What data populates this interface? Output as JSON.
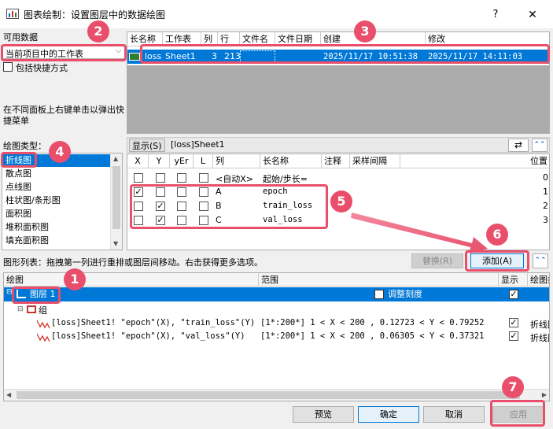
{
  "window": {
    "title": "图表绘制：设置图层中的数据绘图",
    "help_label": "?",
    "close_label": "✕"
  },
  "left": {
    "available_data_label": "可用数据",
    "source_selected": "当前项目中的工作表",
    "shortcut_label": "包括快捷方式",
    "hint": "在不同面板上右键单击以弹出快捷菜单",
    "plot_type_label": "绘图类型：",
    "plot_types": [
      "折线图",
      "散点图",
      "点线图",
      "柱状图/条形图",
      "面积图",
      "堆积面积图",
      "填充面积图"
    ]
  },
  "worksheets": {
    "columns": [
      "长名称",
      "工作表",
      "列",
      "行",
      "文件名",
      "文件日期",
      "创建",
      "修改"
    ],
    "rows": [
      {
        "long_name": "loss",
        "sheet": "Sheet1",
        "cols": "3",
        "rows": "213",
        "file_name": "",
        "file_date": "",
        "created": "2025/11/17 10:51:38",
        "modified": "2025/11/17 14:11:03"
      }
    ]
  },
  "showbar": {
    "show_label": "显示(S)",
    "sheet_ref": "[loss]Sheet1",
    "swap_icon": "swap-icon",
    "collapse_icon": "double-chevron-up-icon"
  },
  "columns_table": {
    "headers": [
      "X",
      "Y",
      "yEr",
      "L",
      "列",
      "长名称",
      "注释",
      "采样间隔",
      "位置"
    ],
    "rows": [
      {
        "x": false,
        "y": false,
        "yer": false,
        "l": false,
        "col": "<自动X>",
        "name": "起始/步长=",
        "comment": "",
        "interval": "",
        "pos": "0"
      },
      {
        "x": true,
        "y": false,
        "yer": false,
        "l": false,
        "col": "A",
        "name": "epoch",
        "comment": "",
        "interval": "",
        "pos": "1"
      },
      {
        "x": false,
        "y": true,
        "yer": false,
        "l": false,
        "col": "B",
        "name": "train_loss",
        "comment": "",
        "interval": "",
        "pos": "2"
      },
      {
        "x": false,
        "y": true,
        "yer": false,
        "l": false,
        "col": "C",
        "name": "val_loss",
        "comment": "",
        "interval": "",
        "pos": "3"
      }
    ]
  },
  "graph_list": {
    "label": "图形列表：拖拽第一列进行重排或图层间移动。右击获得更多选项。",
    "replace_label": "替换(R)",
    "add_label": "添加(A)"
  },
  "tree": {
    "headers": [
      "绘图",
      "范围",
      "显示",
      "绘图类型"
    ],
    "layer": {
      "name": "图层 1",
      "rescale_label": "调整刻度",
      "show": true
    },
    "group_label": "组",
    "plots": [
      {
        "name": "[loss]Sheet1! \"epoch\"(X), \"train_loss\"(Y)",
        "range": "[1*:200*]   1 < X < 200 , 0.12723 < Y < 0.79252",
        "show": true,
        "type": "折线图"
      },
      {
        "name": "[loss]Sheet1! \"epoch\"(X), \"val_loss\"(Y)",
        "range": "[1*:200*]   1 < X < 200 , 0.06305 < Y < 0.37321",
        "show": true,
        "type": "折线图"
      }
    ]
  },
  "buttons": {
    "preview": "预览",
    "ok": "确定",
    "cancel": "取消",
    "apply": "应用"
  },
  "callouts": [
    "1",
    "2",
    "3",
    "4",
    "5",
    "6",
    "7"
  ],
  "colors": {
    "accent": "#0078d7",
    "callout": "#e94f6a"
  }
}
